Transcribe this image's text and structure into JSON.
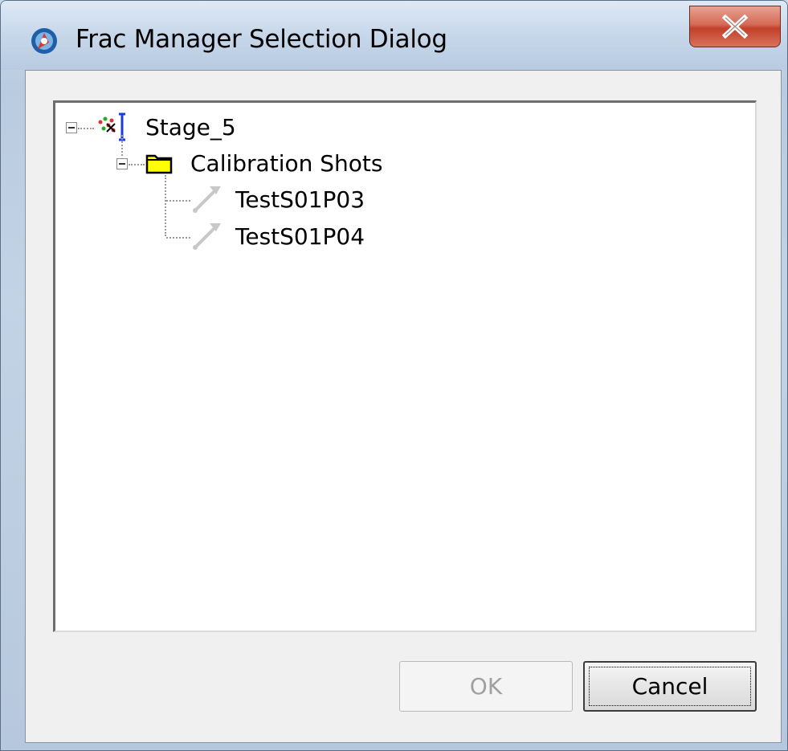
{
  "window": {
    "title": "Frac Manager Selection Dialog",
    "close_icon": "close-x-icon"
  },
  "tree": {
    "root": {
      "label": "Stage_5",
      "expanded": true,
      "icon": "stage-icon",
      "children": [
        {
          "label": "Calibration Shots",
          "expanded": true,
          "icon": "folder-icon",
          "children": [
            {
              "label": "TestS01P03",
              "icon": "shot-icon"
            },
            {
              "label": "TestS01P04",
              "icon": "shot-icon"
            }
          ]
        }
      ]
    }
  },
  "buttons": {
    "ok_label": "OK",
    "ok_enabled": false,
    "cancel_label": "Cancel"
  },
  "colors": {
    "folder": "#ffff00",
    "close_button": "#c7432d"
  }
}
